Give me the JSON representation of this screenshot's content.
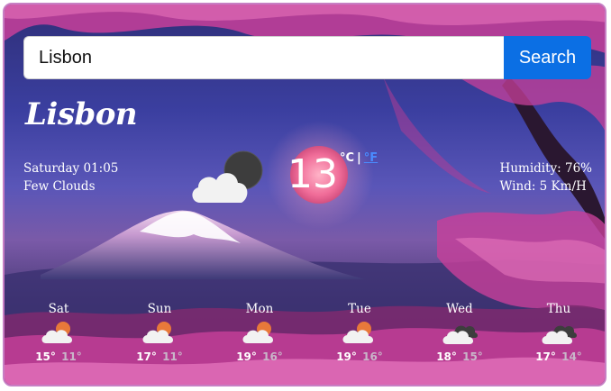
{
  "search": {
    "value": "Lisbon",
    "button_label": "Search"
  },
  "current": {
    "city": "Lisbon",
    "datetime": "Saturday 01:05",
    "description": "Few Clouds",
    "icon": "night-cloud-icon",
    "temperature": "13",
    "unit_c": "°C",
    "unit_sep": "|",
    "unit_f": "°F",
    "humidity": "Humidity: 76%",
    "wind": "Wind: 5 Km/H"
  },
  "forecast": [
    {
      "day": "Sat",
      "icon": "sun-cloud-icon",
      "max": "15°",
      "min": "11°"
    },
    {
      "day": "Sun",
      "icon": "sun-cloud-icon",
      "max": "17°",
      "min": "11°"
    },
    {
      "day": "Mon",
      "icon": "sun-cloud-icon",
      "max": "19°",
      "min": "16°"
    },
    {
      "day": "Tue",
      "icon": "sun-cloud-icon",
      "max": "19°",
      "min": "16°"
    },
    {
      "day": "Wed",
      "icon": "dark-cloud-icon",
      "max": "18°",
      "min": "15°"
    },
    {
      "day": "Thu",
      "icon": "dark-cloud-icon",
      "max": "17°",
      "min": "14°"
    }
  ],
  "colors": {
    "accent": "#0b6fe4",
    "unit_link": "#4a8cff",
    "card_border": "#c77fc4"
  }
}
